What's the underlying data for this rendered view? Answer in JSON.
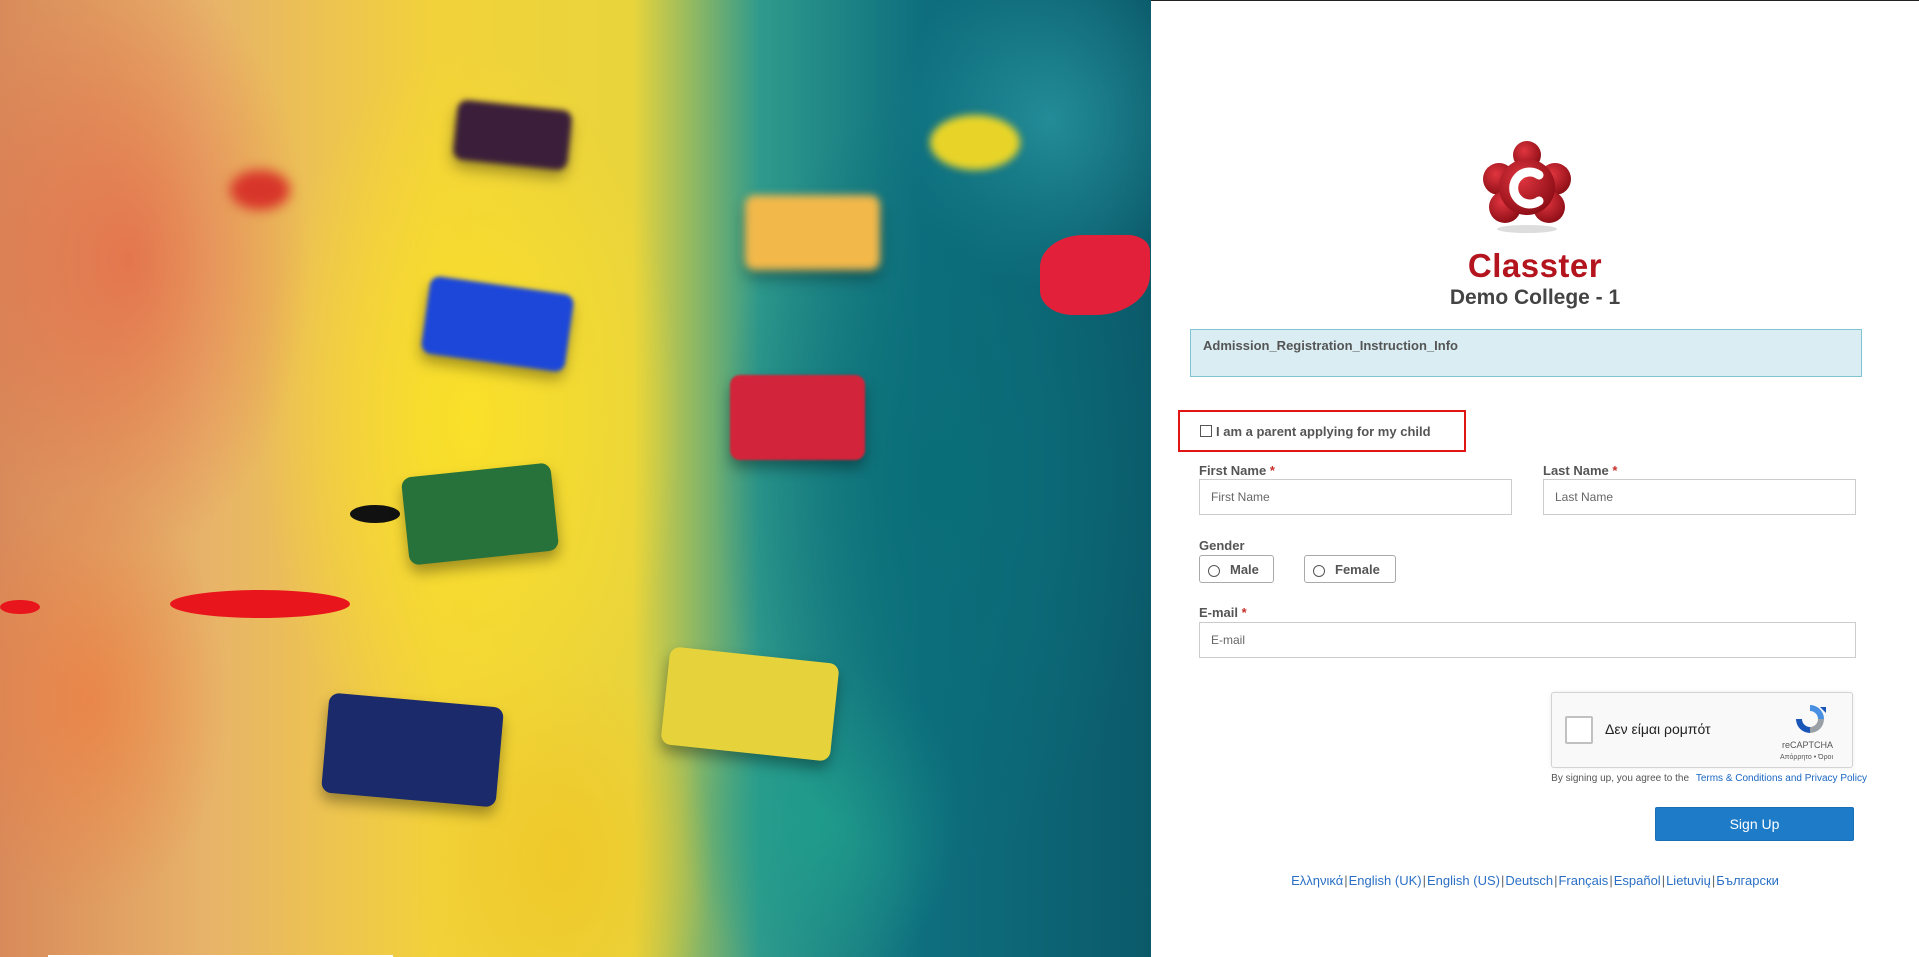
{
  "brand": {
    "name": "Classter",
    "subtitle": "Demo College - 1",
    "accent_color": "#b4141e"
  },
  "info_box": {
    "text": "Admission_Registration_Instruction_Info"
  },
  "parent_checkbox": {
    "label": "I am a parent applying for my child",
    "checked": false
  },
  "form": {
    "first_name": {
      "label": "First Name",
      "required": "*",
      "placeholder": "First Name",
      "value": ""
    },
    "last_name": {
      "label": "Last Name",
      "required": "*",
      "placeholder": "Last Name",
      "value": ""
    },
    "gender": {
      "label": "Gender",
      "options": [
        "Male",
        "Female"
      ]
    },
    "email": {
      "label": "E-mail",
      "required": "*",
      "placeholder": "E-mail",
      "value": ""
    }
  },
  "recaptcha": {
    "label": "Δεν είμαι ρομπότ",
    "brand": "reCAPTCHA",
    "terms": "Απόρρητο • Όροι"
  },
  "terms": {
    "prefix": "By signing up, you agree to the",
    "link": "Terms & Conditions and Privacy Policy"
  },
  "signup_button": {
    "label": "Sign Up",
    "color": "#1e7bc8"
  },
  "languages": [
    "Ελληνικά",
    "English (UK)",
    "English (US)",
    "Deutsch",
    "Français",
    "Español",
    "Lietuvių",
    "Български"
  ]
}
